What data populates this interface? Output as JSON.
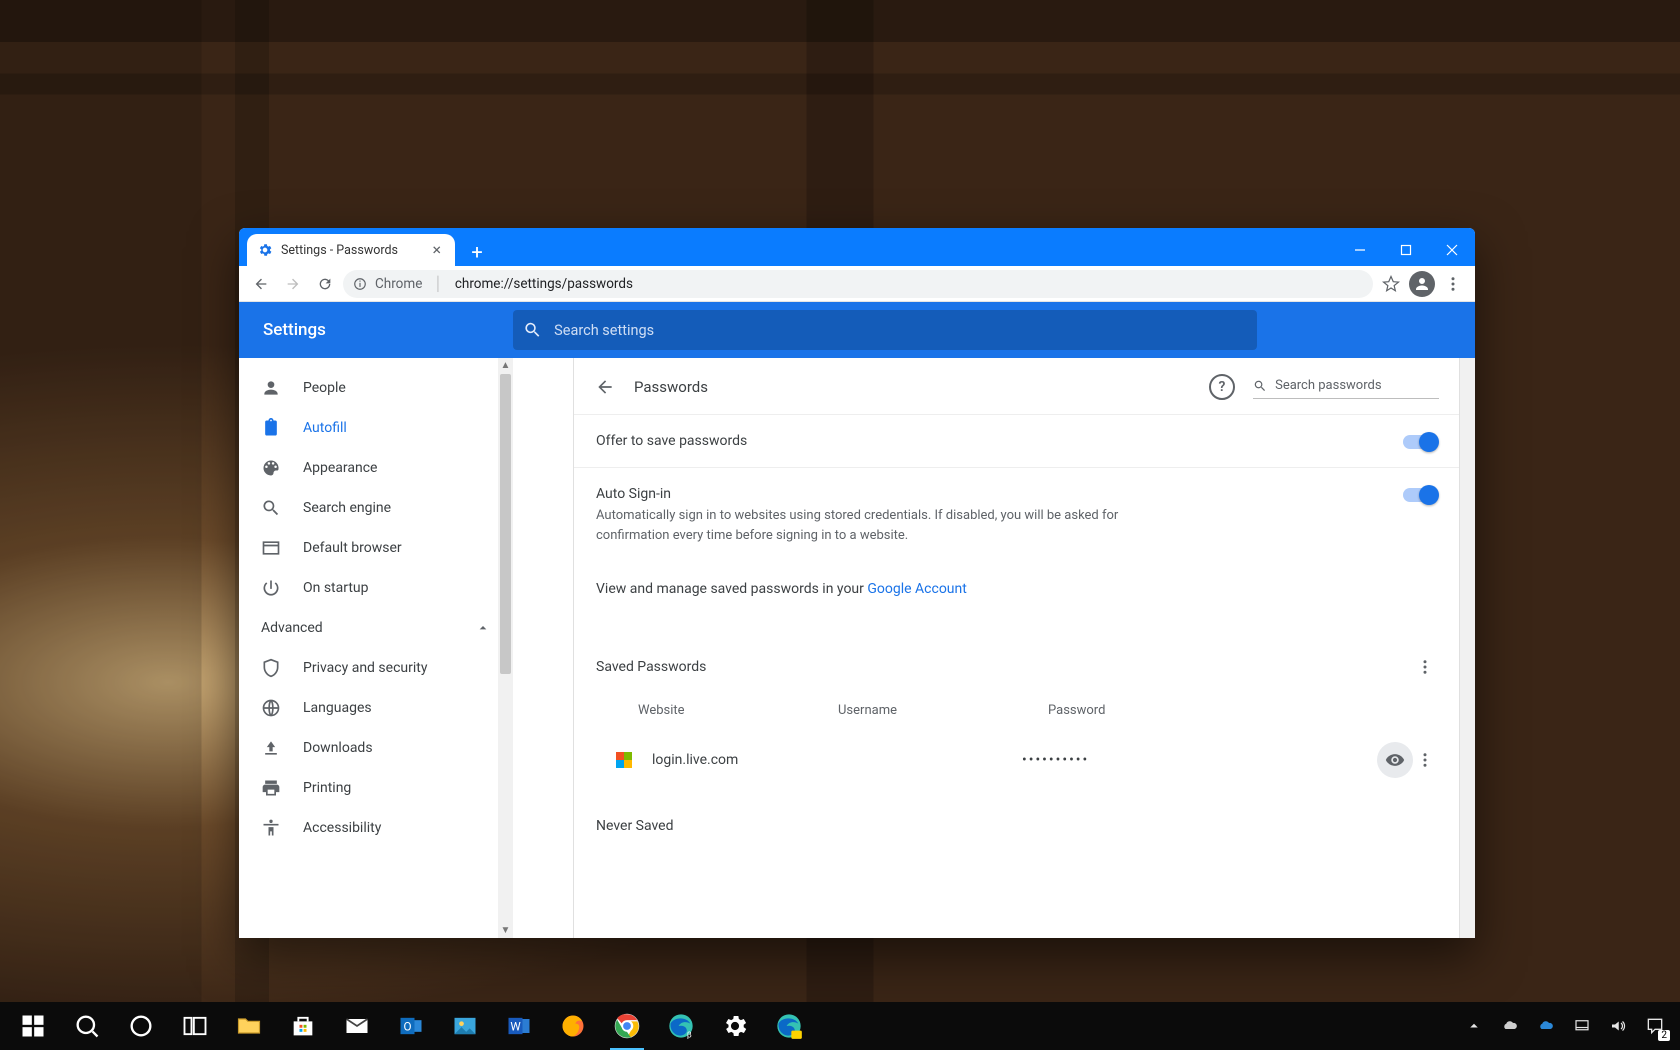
{
  "tab": {
    "title": "Settings - Passwords"
  },
  "omnibox": {
    "site": "Chrome",
    "url": "chrome://settings/passwords"
  },
  "settings": {
    "title": "Settings",
    "search_placeholder": "Search settings"
  },
  "sidebar": {
    "items": [
      {
        "label": "People"
      },
      {
        "label": "Autofill"
      },
      {
        "label": "Appearance"
      },
      {
        "label": "Search engine"
      },
      {
        "label": "Default browser"
      },
      {
        "label": "On startup"
      }
    ],
    "advanced_label": "Advanced",
    "advanced_items": [
      {
        "label": "Privacy and security"
      },
      {
        "label": "Languages"
      },
      {
        "label": "Downloads"
      },
      {
        "label": "Printing"
      },
      {
        "label": "Accessibility"
      }
    ]
  },
  "panel": {
    "title": "Passwords",
    "search_placeholder": "Search passwords",
    "offer_label": "Offer to save passwords",
    "autosign_label": "Auto Sign-in",
    "autosign_sub": "Automatically sign in to websites using stored credentials. If disabled, you will be asked for confirmation every time before signing in to a website.",
    "info_text": "View and manage saved passwords in your ",
    "info_link": "Google Account",
    "saved_heading": "Saved Passwords",
    "cols": {
      "website": "Website",
      "username": "Username",
      "password": "Password"
    },
    "entry": {
      "site": "login.live.com",
      "username": "",
      "password_mask": "••••••••••"
    },
    "never_heading": "Never Saved"
  },
  "taskbar": {
    "notification_count": "2"
  }
}
